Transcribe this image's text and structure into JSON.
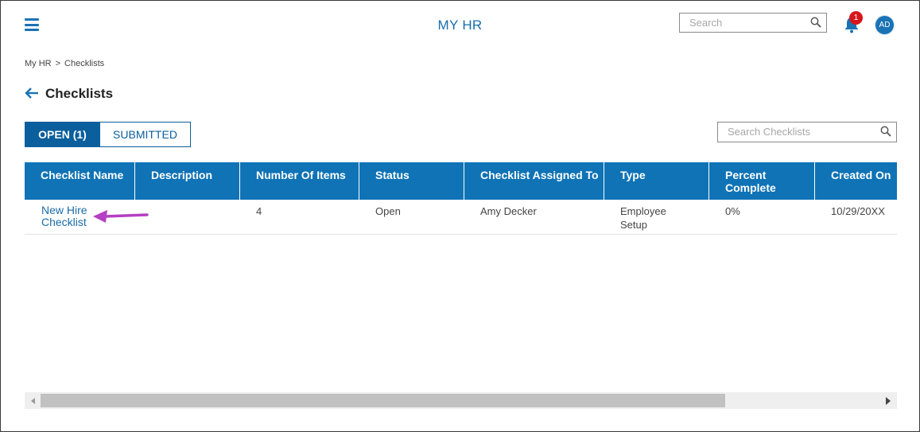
{
  "header": {
    "title": "MY HR",
    "search_placeholder": "Search",
    "notification_count": "1",
    "avatar_initials": "AD",
    "menu_icon": "hamburger-icon",
    "bell_icon": "bell-icon",
    "search_icon": "magnifier-icon"
  },
  "breadcrumb": {
    "root": "My HR",
    "separator": ">",
    "current": "Checklists"
  },
  "page": {
    "title": "Checklists",
    "back_icon": "left-arrow-icon"
  },
  "tabs": [
    {
      "label": "OPEN (1)",
      "active": true
    },
    {
      "label": "SUBMITTED",
      "active": false
    }
  ],
  "checklist_search": {
    "placeholder": "Search Checklists"
  },
  "table": {
    "columns": [
      "Checklist Name",
      "Description",
      "Number Of Items",
      "Status",
      "Checklist Assigned To",
      "Type",
      "Percent Complete",
      "Created On"
    ],
    "rows": [
      {
        "name": "New Hire Checklist",
        "description": "",
        "number_of_items": "4",
        "status": "Open",
        "assigned_to": "Amy Decker",
        "type": "Employee Setup",
        "percent_complete": "0%",
        "created_on": "10/29/20XX"
      }
    ]
  },
  "colors": {
    "accent": "#0f73b6",
    "tab_active": "#0a5f9c",
    "badge": "#d6161b",
    "annotation_arrow": "#b43fc2"
  }
}
